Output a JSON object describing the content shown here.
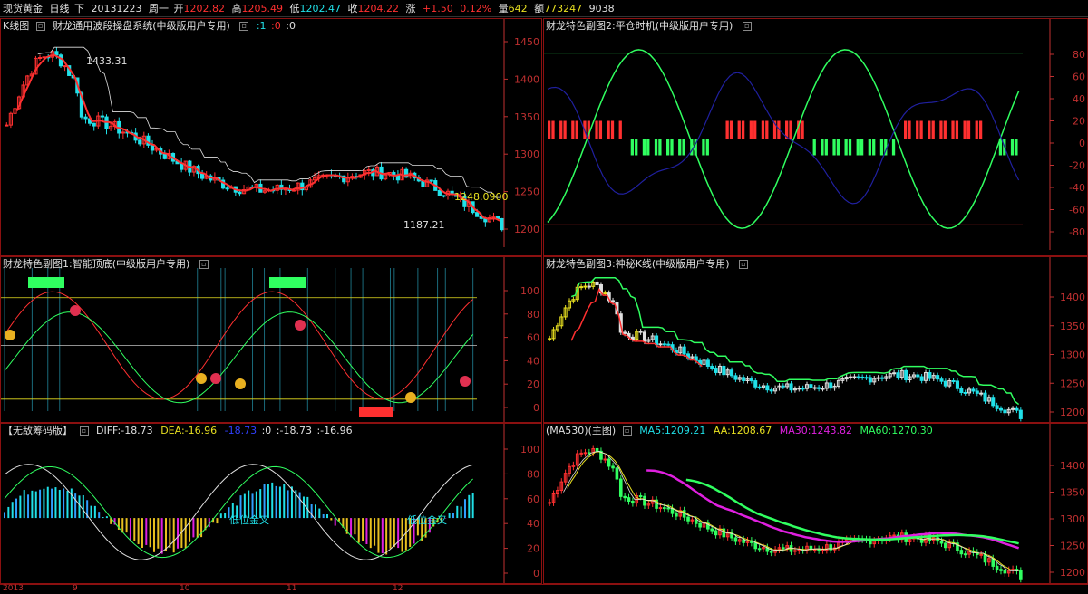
{
  "topbar": {
    "symbol": "现货黄金",
    "period": "日线",
    "dir": "下",
    "date": "20131223",
    "weekday": "周一",
    "open_label": "开",
    "open": "1202.82",
    "high_label": "高",
    "high": "1205.49",
    "low_label": "低",
    "low": "1202.47",
    "close_label": "收",
    "close": "1204.22",
    "change_label": "涨",
    "change": "+1.50",
    "change_pct": "0.12%",
    "volume_label": "量",
    "volume": "642",
    "amount_label": "额",
    "amount": "773247",
    "extra": "9038"
  },
  "colors": {
    "red": "#ff3030",
    "green": "#30ff60",
    "cyan": "#20e0e8",
    "yellow": "#e8e020",
    "magenta": "#e020e0",
    "white": "#e0e0e0",
    "blue": "#2020a0",
    "axis": "#c03030"
  },
  "panes": {
    "kline": {
      "title": "K线图",
      "indicator": "财龙通用波段操盘系统(中级版用户专用)",
      "params": [
        ":1",
        ":0",
        ":0"
      ],
      "y_ticks": [
        "1450",
        "1400",
        "1350",
        "1300",
        "1250",
        "1200"
      ],
      "annot_high": "1433.31",
      "annot_low": "1187.21",
      "annot_price": "1248.0900"
    },
    "sub2": {
      "title": "财龙特色副图2:平仓时机(中级版用户专用)",
      "y_ticks": [
        "80",
        "60",
        "40",
        "20",
        "0",
        "-20",
        "-40",
        "-60",
        "-80"
      ]
    },
    "sub1": {
      "title": "财龙特色副图1:智能顶底(中级版用户专用)",
      "y_ticks": [
        "100",
        "80",
        "60",
        "40",
        "20",
        "0"
      ]
    },
    "sub3": {
      "title": "财龙特色副图3:神秘K线(中级版用户专用)",
      "y_ticks": [
        "1400",
        "1350",
        "1300",
        "1250",
        "1200"
      ]
    },
    "macd": {
      "title": "【无敌筹码版】",
      "diff_label": "DIFF:-18.73",
      "dea_label": "DEA:-16.96",
      "v3": "-18.73",
      "v4": ":0",
      "v5": ":-18.73",
      "v6": ":-16.96",
      "y_ticks": [
        "100",
        "80",
        "60",
        "40",
        "20",
        "0"
      ],
      "cross_labels": [
        "低位金叉",
        "低位金叉"
      ]
    },
    "ma": {
      "title": "(MA530)(主图)",
      "ma5": "MA5:1209.21",
      "aa": "AA:1208.67",
      "ma30": "MA30:1243.82",
      "ma60": "MA60:1270.30",
      "y_ticks": [
        "1400",
        "1350",
        "1300",
        "1250",
        "1200"
      ]
    }
  },
  "bottom_dates": [
    "2013",
    "9",
    "10",
    "11",
    "12"
  ]
}
